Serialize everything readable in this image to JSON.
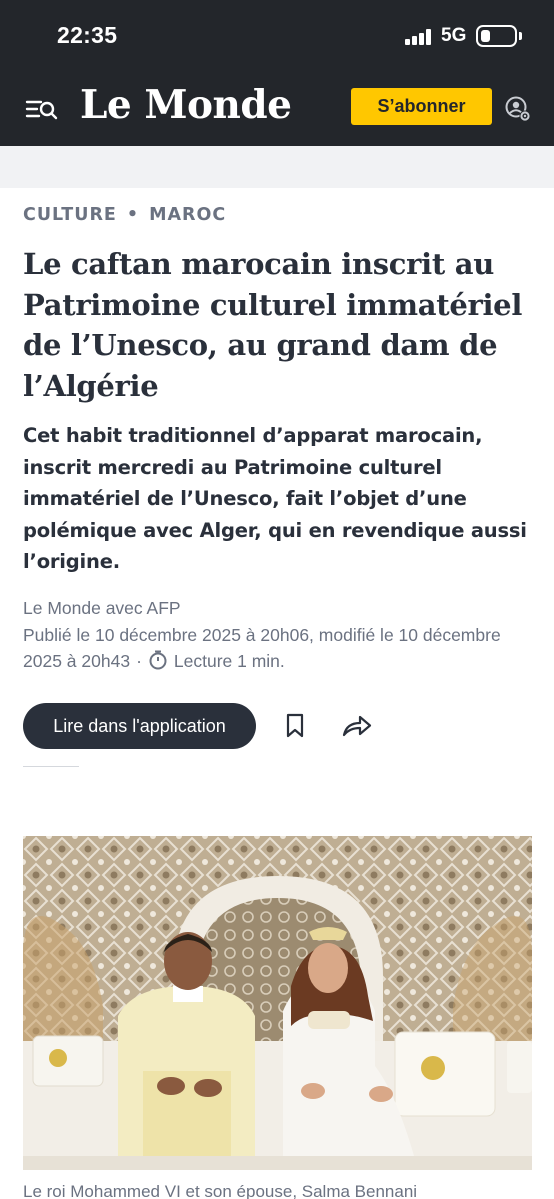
{
  "status_bar": {
    "time": "22:35",
    "network": "5G"
  },
  "header": {
    "logo": "Le Monde",
    "subscribe_label": "S’abonner",
    "icons": {
      "menu": "menu-search-icon",
      "account": "account-settings-icon"
    }
  },
  "article": {
    "kicker": {
      "section": "CULTURE",
      "subsection": "MAROC"
    },
    "headline": "Le caftan marocain inscrit au Patrimoine culturel immatériel de l’Unesco, au grand dam de l’Algérie",
    "lede": "Cet habit traditionnel d’apparat marocain, inscrit mercredi au Patrimoine culturel immatériel de l’Unesco, fait l’objet d’une polémique avec Alger, qui en revendique aussi l’origine.",
    "byline": "Le Monde avec AFP",
    "dates": "Publié le 10 décembre 2025 à 20h06, modifié le 10 décembre 2025 à 20h43",
    "reading_time": "Lecture 1 min.",
    "app_button_label": "Lire dans l'application",
    "icons": {
      "bookmark": "bookmark-icon",
      "share": "share-icon",
      "clock": "clock-icon"
    },
    "caption": "Le roi Mohammed VI et son épouse, Salma Bennani"
  },
  "colors": {
    "header_bg": "#23262b",
    "accent_yellow": "#ffc700",
    "text_dark": "#2a303b",
    "text_muted": "#6b7281"
  }
}
